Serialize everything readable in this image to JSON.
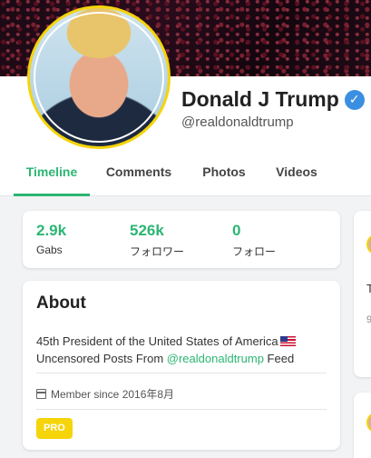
{
  "profile": {
    "display_name": "Donald J Trump",
    "username": "@realdonaldtrump",
    "verified_icon": "verified-check-icon"
  },
  "tabs": [
    {
      "label": "Timeline",
      "active": true
    },
    {
      "label": "Comments",
      "active": false
    },
    {
      "label": "Photos",
      "active": false
    },
    {
      "label": "Videos",
      "active": false
    }
  ],
  "stats": [
    {
      "value": "2.9k",
      "label": "Gabs"
    },
    {
      "value": "526k",
      "label": "フォロワー"
    },
    {
      "value": "0",
      "label": "フォロー"
    }
  ],
  "about": {
    "title": "About",
    "bio_line1": "45th President of the United States of America",
    "bio_prefix": "Uncensored Posts From ",
    "bio_mention": "@realdonaldtrump",
    "bio_suffix": " Feed",
    "member_since": "Member since 2016年8月",
    "badge": "PRO"
  },
  "side_fragments": {
    "letter": "T",
    "digit": "9"
  },
  "colors": {
    "accent": "#2bb673",
    "verified": "#3b8fe0",
    "pro_badge": "#f5d40a"
  }
}
